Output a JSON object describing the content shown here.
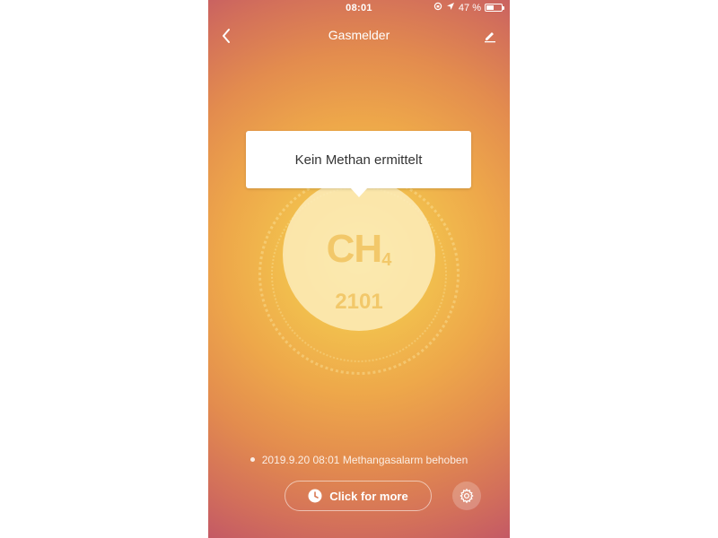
{
  "status_bar": {
    "time": "08:01",
    "battery_text": "47 %",
    "battery_level": 0.47
  },
  "nav": {
    "title": "Gasmelder",
    "back_icon": "chevron-left-icon",
    "edit_icon": "pencil-icon"
  },
  "sensor": {
    "formula_main": "CH",
    "formula_sub": "4",
    "value": "2101"
  },
  "tooltip": {
    "text": "Kein Methan ermittelt"
  },
  "event": {
    "text": "2019.9.20 08:01 Methangasalarm behoben"
  },
  "actions": {
    "more_label": "Click for more",
    "more_icon": "clock-icon",
    "settings_icon": "gear-icon"
  },
  "colors": {
    "accent": "#f2c86a",
    "bg_top": "#b84a6d",
    "bg_center": "#f5d36a"
  }
}
